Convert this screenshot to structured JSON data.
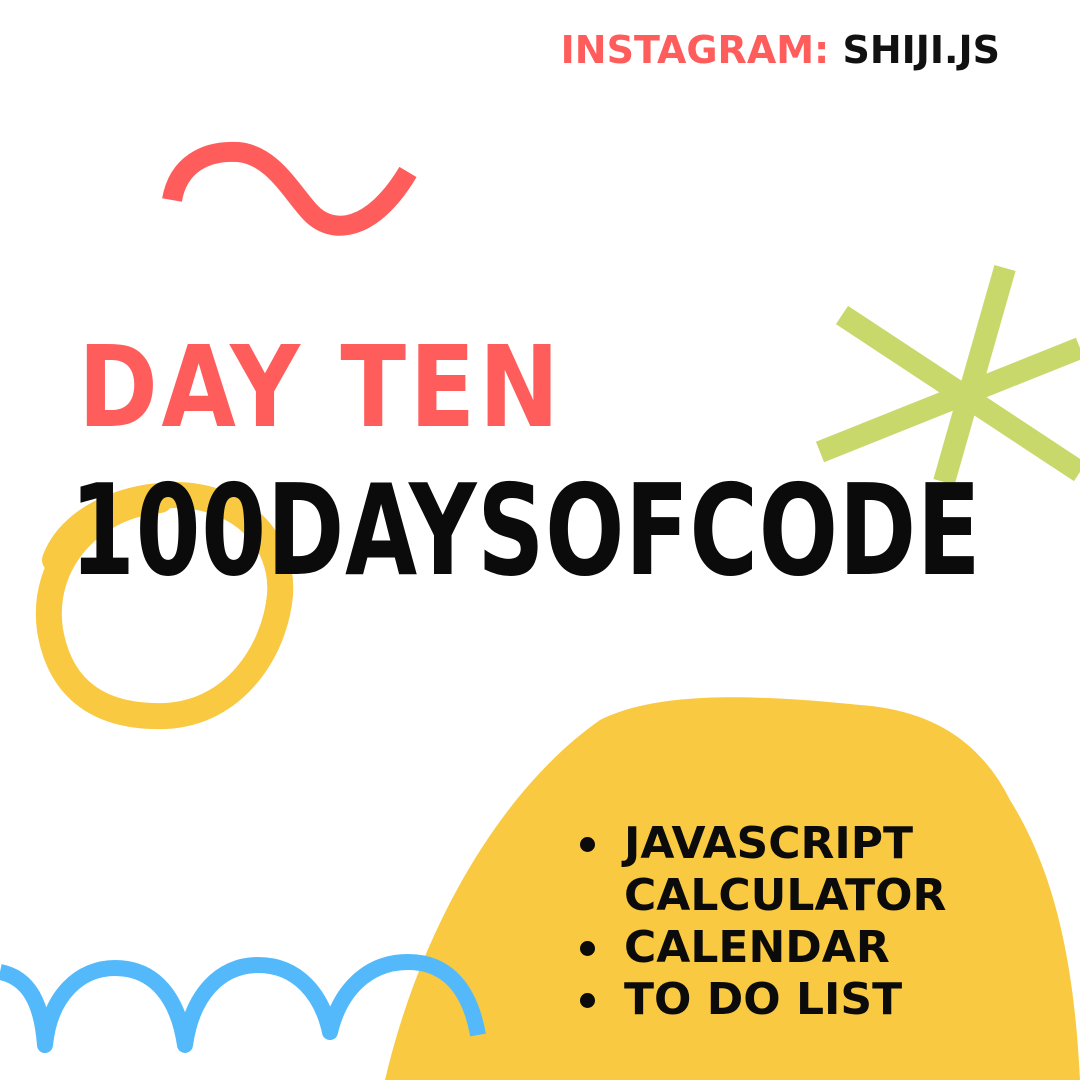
{
  "credit": {
    "label": "INSTAGRAM:",
    "handle": "SHIJI.JS"
  },
  "heading": {
    "day": "DAY TEN",
    "tag": "100DAYSOFCODE"
  },
  "topics": [
    {
      "line1": "JAVASCRIPT",
      "line2": "CALCULATOR"
    },
    {
      "line1": "CALENDAR",
      "line2": ""
    },
    {
      "line1": "TO DO LIST",
      "line2": ""
    }
  ],
  "colors": {
    "background": "#ffffff",
    "coral": "#ff5c5c",
    "black": "#0b0b0b",
    "yellow": "#f9c942",
    "lime": "#c9d86a",
    "blue": "#54b9fb"
  },
  "decorations": [
    "squiggle-shape",
    "asterisk-shape",
    "circle-ring-shape",
    "blob-shape",
    "scallop-wave-shape"
  ]
}
